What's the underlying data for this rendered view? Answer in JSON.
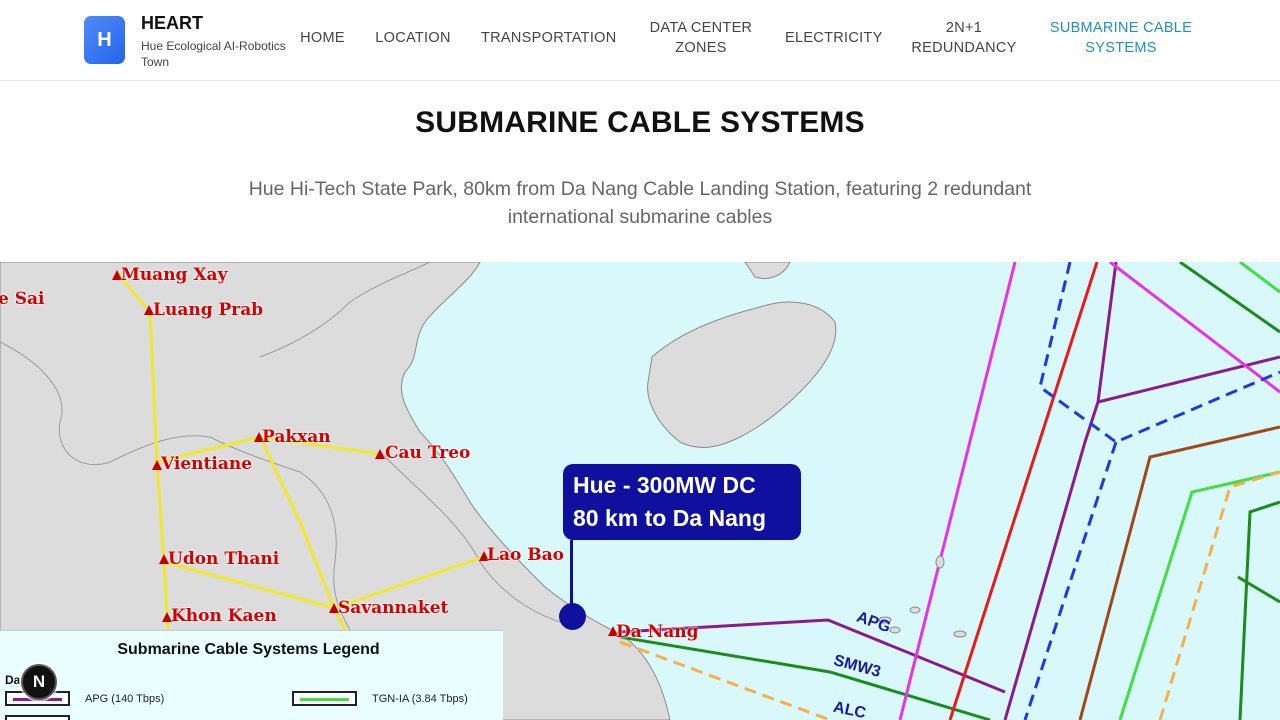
{
  "brand": {
    "logo_letter": "H",
    "title": "HEART",
    "subtitle": "Hue Ecological AI-Robotics Town"
  },
  "nav": [
    {
      "label": "HOME",
      "active": false
    },
    {
      "label": "LOCATION",
      "active": false
    },
    {
      "label": "TRANSPORTATION",
      "active": false
    },
    {
      "label": "DATA CENTER ZONES",
      "active": false
    },
    {
      "label": "ELECTRICITY",
      "active": false
    },
    {
      "label": "2N+1 REDUNDANCY",
      "active": false
    },
    {
      "label": "SUBMARINE CABLE SYSTEMS",
      "active": true
    }
  ],
  "page": {
    "title": "SUBMARINE CABLE SYSTEMS",
    "description": "Hue Hi-Tech State Park, 80km from Da Nang Cable Landing Station, featuring 2 redundant international submarine cables"
  },
  "map": {
    "callout_line1": "Hue - 300MW DC",
    "callout_line2": "80 km to Da Nang",
    "cities": [
      "Muang Xay",
      "Luang Prab",
      "e Sai",
      "Pakxan",
      "Vientiane",
      "Cau Treo",
      "Udon Thani",
      "Lao Bao",
      "Khon Kaen",
      "Savannaket",
      "Da Nang"
    ],
    "cable_labels": [
      "APG",
      "SMW3",
      "ALC"
    ]
  },
  "legend": {
    "title": "Submarine Cable Systems Legend",
    "group": "Da Nang:",
    "items": [
      {
        "label": "APG (140 Tbps)",
        "color": "#8b1a8b"
      },
      {
        "label": "TGN-IA (3.84 Tbps)",
        "color": "#44dd44"
      }
    ]
  },
  "colors": {
    "accent": "#1e90c8",
    "logo": "#2563eb",
    "callout": "#10109e",
    "city_text": "#d40000"
  },
  "badge": {
    "label": "N"
  }
}
